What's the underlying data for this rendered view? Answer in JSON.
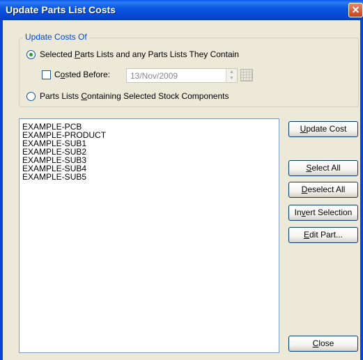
{
  "window": {
    "title": "Update Parts List Costs",
    "close_glyph": "✕"
  },
  "group": {
    "legend": "Update Costs Of",
    "option1": {
      "pre": "Selected ",
      "u": "P",
      "post": "arts Lists and any Parts Lists They Contain",
      "checked": true
    },
    "costed": {
      "pre": "C",
      "u": "o",
      "post": "sted Before:",
      "checked": false,
      "date": "13/Nov/2009"
    },
    "option2": {
      "pre": "Parts Lists ",
      "u": "C",
      "post": "ontaining Selected Stock Components",
      "checked": false
    }
  },
  "list": {
    "items": [
      "EXAMPLE-PCB",
      "EXAMPLE-PRODUCT",
      "EXAMPLE-SUB1",
      "EXAMPLE-SUB2",
      "EXAMPLE-SUB3",
      "EXAMPLE-SUB4",
      "EXAMPLE-SUB5"
    ]
  },
  "buttons": {
    "update_cost": {
      "u": "U",
      "rest": "pdate Cost"
    },
    "select_all": {
      "u": "S",
      "rest": "elect All"
    },
    "deselect_all": {
      "u": "D",
      "rest": "eselect All"
    },
    "invert_selection": {
      "pre": "In",
      "u": "v",
      "rest": "ert Selection"
    },
    "edit_part": {
      "u": "E",
      "rest": "dit Part..."
    },
    "close": {
      "u": "C",
      "rest": "lose"
    }
  },
  "icons": {
    "spin_up": "up-arrow-icon",
    "spin_down": "down-arrow-icon",
    "calendar": "calendar-icon"
  },
  "colors": {
    "titlebar": "#0845d8",
    "legend": "#0046d5",
    "radio_dot": "#21a121"
  }
}
